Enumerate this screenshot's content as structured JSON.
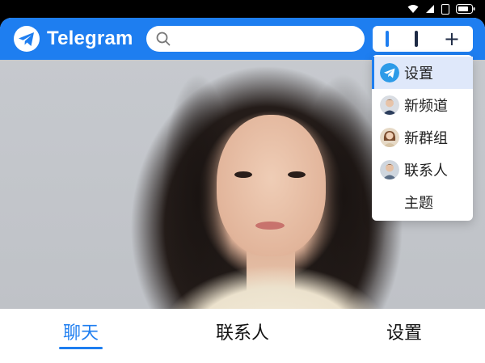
{
  "app": {
    "title": "Telegram"
  },
  "search": {
    "placeholder": "",
    "value": ""
  },
  "top_actions": {
    "add_label": "+"
  },
  "dropdown": {
    "items": [
      {
        "label": "设置",
        "icon": "telegram-icon",
        "active": true
      },
      {
        "label": "新频道",
        "icon": "avatar-male"
      },
      {
        "label": "新群组",
        "icon": "avatar-female"
      },
      {
        "label": "联系人",
        "icon": "avatar-male-2"
      },
      {
        "label": "主题",
        "icon": ""
      }
    ]
  },
  "tabs": [
    {
      "label": "聊天",
      "active": true
    },
    {
      "label": "联系人",
      "active": false
    },
    {
      "label": "设置",
      "active": false
    }
  ],
  "colors": {
    "accent": "#1e7ef0",
    "header_bg": "#1e7ef0",
    "active_item_bg": "#dfe8fa"
  }
}
